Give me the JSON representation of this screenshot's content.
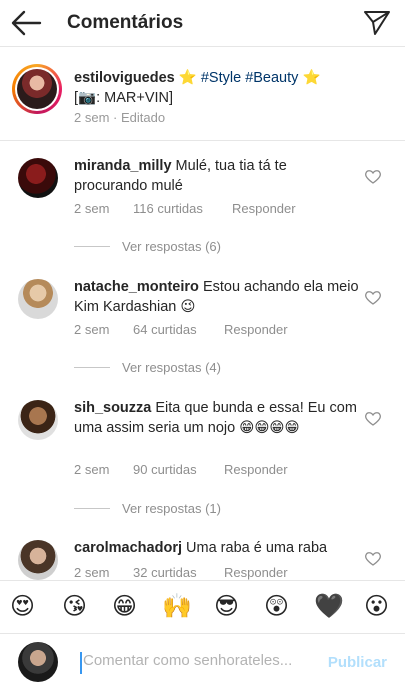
{
  "header": {
    "title": "Comentários",
    "back_icon": "arrow-left-icon",
    "send_icon": "paper-plane-icon"
  },
  "caption": {
    "username": "estiloviguedes",
    "star1": "⭐",
    "tags": "#Style #Beauty",
    "star2": "⭐",
    "line2": "[📷: MAR+VIN]",
    "meta": "2 sem · Editado"
  },
  "comments": [
    {
      "username": "miranda_milly",
      "text": "Mulé, tua tia tá te procurando mulé",
      "time": "2 sem",
      "likes": "116 curtidas",
      "reply": "Responder",
      "view_replies": "Ver respostas (6)"
    },
    {
      "username": "natache_monteiro",
      "text": "Estou achando ela meio Kim Kardashian 😉",
      "time": "2 sem",
      "likes": "64 curtidas",
      "reply": "Responder",
      "view_replies": "Ver respostas (4)"
    },
    {
      "username": "sih_souzza",
      "text": "Eita que bunda e essa! Eu com uma assim seria um nojo 😁😁😁😁",
      "time": "2 sem",
      "likes": "90 curtidas",
      "reply": "Responder",
      "view_replies": "Ver respostas (1)"
    },
    {
      "username": "carolmachadorj",
      "text": "Uma raba é uma raba",
      "time": "2 sem",
      "likes": "32 curtidas",
      "reply": "Responder"
    }
  ],
  "emojis": [
    "😍",
    "😘",
    "😁",
    "🙌",
    "😎",
    "😲",
    "🖤",
    "😮"
  ],
  "composer": {
    "placeholder": "Comentar como senhorateles...",
    "publish": "Publicar"
  },
  "colors": {
    "link": "#003569",
    "muted": "#8e8e8e",
    "publish": "#b2dffc",
    "cursor": "#3897f0"
  }
}
